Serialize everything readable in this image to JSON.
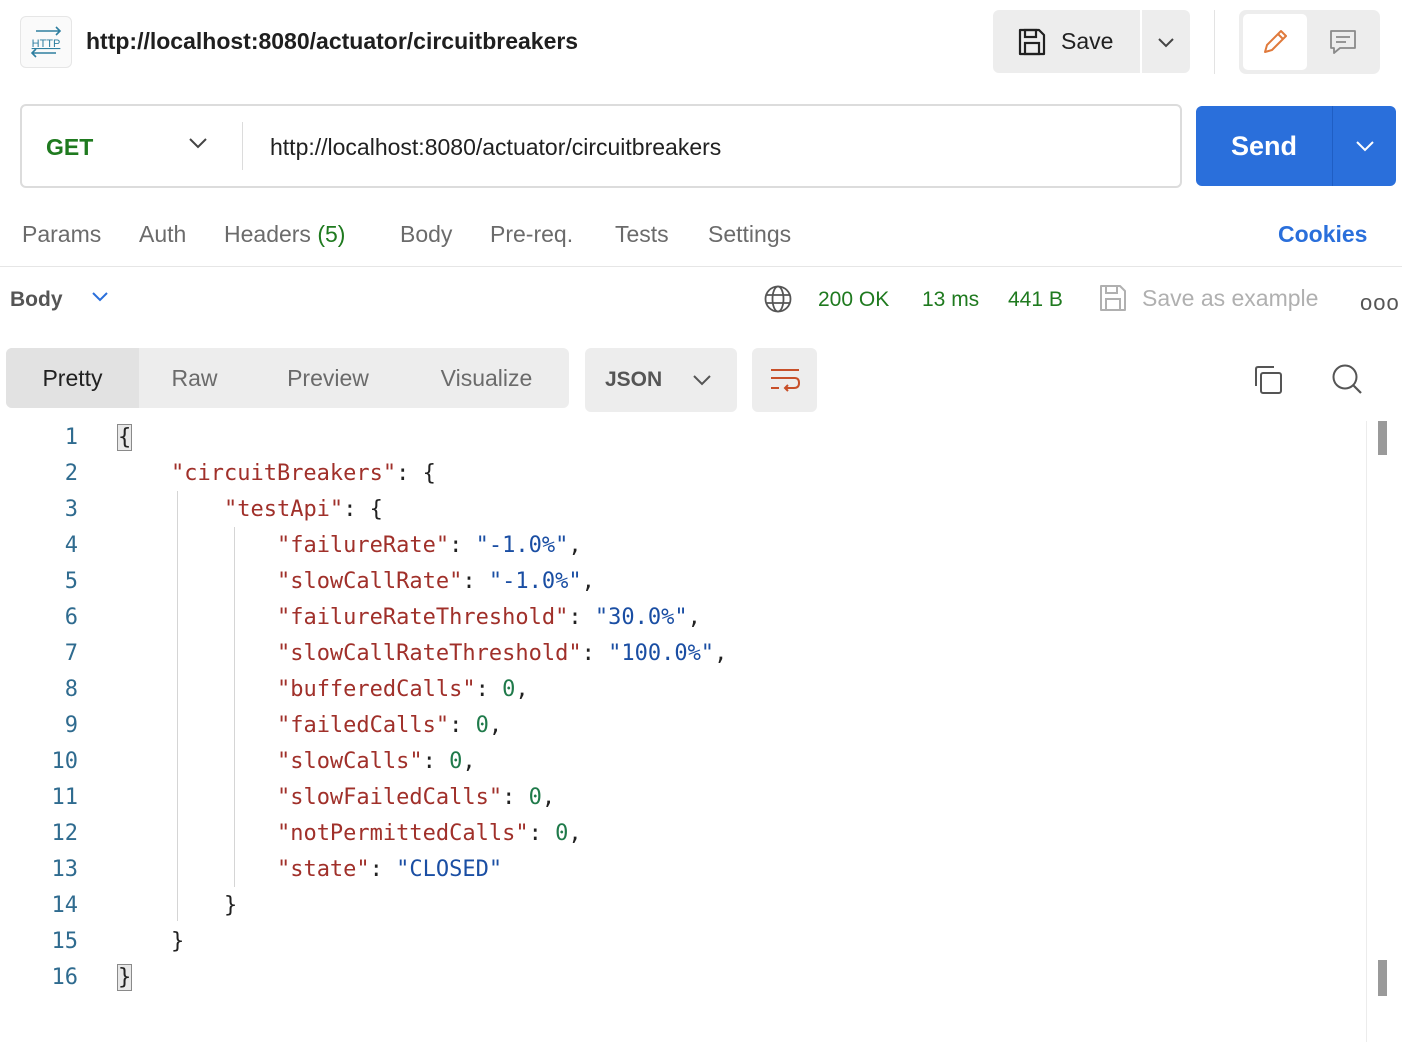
{
  "header": {
    "badge_text": "HTTP",
    "title": "http://localhost:8080/actuator/circuitbreakers",
    "save_label": "Save"
  },
  "request": {
    "method": "GET",
    "url": "http://localhost:8080/actuator/circuitbreakers",
    "send_label": "Send"
  },
  "tabs": {
    "params": "Params",
    "auth": "Auth",
    "headers": "Headers",
    "headers_count": "(5)",
    "body": "Body",
    "prereq": "Pre-req.",
    "tests": "Tests",
    "settings": "Settings",
    "cookies": "Cookies"
  },
  "response": {
    "body_label": "Body",
    "status": "200 OK",
    "time": "13 ms",
    "size": "441 B",
    "save_example": "Save as example",
    "more": "ooo"
  },
  "view": {
    "pretty": "Pretty",
    "raw": "Raw",
    "preview": "Preview",
    "visualize": "Visualize",
    "format": "JSON"
  },
  "code": {
    "line_numbers": [
      "1",
      "2",
      "3",
      "4",
      "5",
      "6",
      "7",
      "8",
      "9",
      "10",
      "11",
      "12",
      "13",
      "14",
      "15",
      "16"
    ],
    "root_open": "{",
    "root_close": "}",
    "cb_key": "\"circuitBreakers\"",
    "cb_close": "}",
    "api_key": "\"testApi\"",
    "api_close": "}",
    "props": [
      {
        "key": "\"failureRate\"",
        "value": "\"-1.0%\"",
        "type": "s",
        "comma": ","
      },
      {
        "key": "\"slowCallRate\"",
        "value": "\"-1.0%\"",
        "type": "s",
        "comma": ","
      },
      {
        "key": "\"failureRateThreshold\"",
        "value": "\"30.0%\"",
        "type": "s",
        "comma": ","
      },
      {
        "key": "\"slowCallRateThreshold\"",
        "value": "\"100.0%\"",
        "type": "s",
        "comma": ","
      },
      {
        "key": "\"bufferedCalls\"",
        "value": "0",
        "type": "n",
        "comma": ","
      },
      {
        "key": "\"failedCalls\"",
        "value": "0",
        "type": "n",
        "comma": ","
      },
      {
        "key": "\"slowCalls\"",
        "value": "0",
        "type": "n",
        "comma": ","
      },
      {
        "key": "\"slowFailedCalls\"",
        "value": "0",
        "type": "n",
        "comma": ","
      },
      {
        "key": "\"notPermittedCalls\"",
        "value": "0",
        "type": "n",
        "comma": ","
      },
      {
        "key": "\"state\"",
        "value": "\"CLOSED\"",
        "type": "s",
        "comma": ""
      }
    ]
  },
  "icons": {
    "http": "http-icon",
    "save": "floppy-disk-icon",
    "edit": "pencil-icon",
    "comment": "comment-icon",
    "globe": "globe-icon",
    "copy": "copy-icon",
    "search": "search-icon",
    "wrap": "wrap-lines-icon"
  },
  "colors": {
    "send": "#2a6fdb",
    "method": "#1f7a1f",
    "status": "#1f7a1f",
    "json_key": "#a0302a",
    "json_string": "#1a4ea3",
    "json_number": "#1f7a4a",
    "edit_icon": "#e07a3c"
  }
}
